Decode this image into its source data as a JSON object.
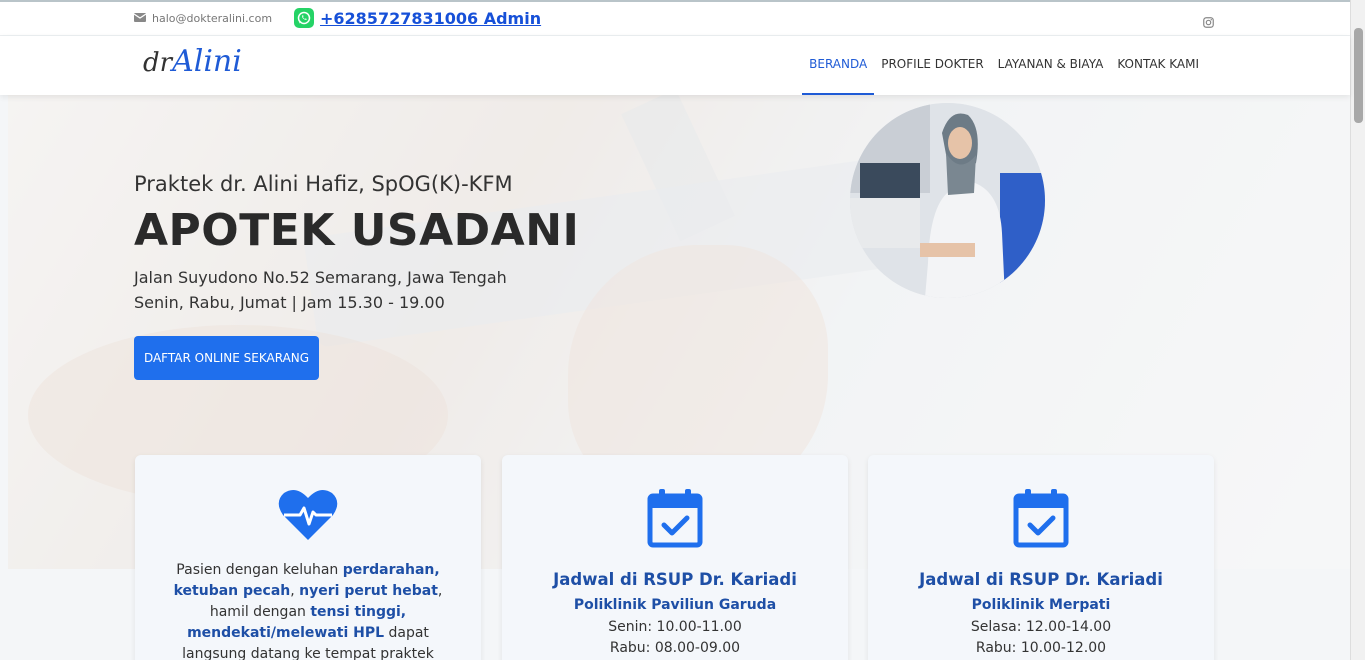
{
  "topbar": {
    "email": "halo@dokteralini.com",
    "whatsapp": "+6285727831006 Admin",
    "icons": [
      "mail-icon",
      "whatsapp-icon",
      "instagram-icon"
    ]
  },
  "logo": {
    "prefix": "dr",
    "name": "Alini"
  },
  "nav": {
    "items": [
      "BERANDA",
      "PROFILE DOKTER",
      "LAYANAN & BIAYA",
      "KONTAK KAMI"
    ],
    "active": "BERANDA"
  },
  "hero": {
    "subtitle": "Praktek dr. Alini Hafiz, SpOG(K)-KFM",
    "title": "APOTEK USADANI",
    "address": "Jalan Suyudono No.52 Semarang, Jawa Tengah",
    "hours": "Senin, Rabu, Jumat | Jam 15.30 - 19.00",
    "cta": "DAFTAR ONLINE SEKARANG"
  },
  "cards": {
    "emergency": {
      "icon": "heartbeat-icon",
      "t1": "Pasien dengan keluhan ",
      "h1": "perdarahan, ketuban pecah",
      "t2": ", ",
      "h2": "nyeri perut hebat",
      "t3": ", hamil dengan ",
      "h3": "tensi tinggi, mendekati/melewati HPL",
      "t4": " dapat langsung datang ke tempat praktek tanpa perjanjian."
    },
    "kariadi1": {
      "icon": "calendar-check-icon",
      "title": "Jadwal di RSUP Dr. Kariadi",
      "subtitle": "Poliklinik Paviliun Garuda",
      "line1": "Senin: 10.00-11.00",
      "line2": "Rabu: 08.00-09.00"
    },
    "kariadi2": {
      "icon": "calendar-check-icon",
      "title": "Jadwal di RSUP Dr. Kariadi",
      "subtitle": "Poliklinik Merpati",
      "line1": "Selasa: 12.00-14.00",
      "line2": "Rabu: 10.00-12.00"
    }
  },
  "colors": {
    "primary": "#1f6fed",
    "heading": "#1e4fa6",
    "whatsapp": "#25d366"
  }
}
